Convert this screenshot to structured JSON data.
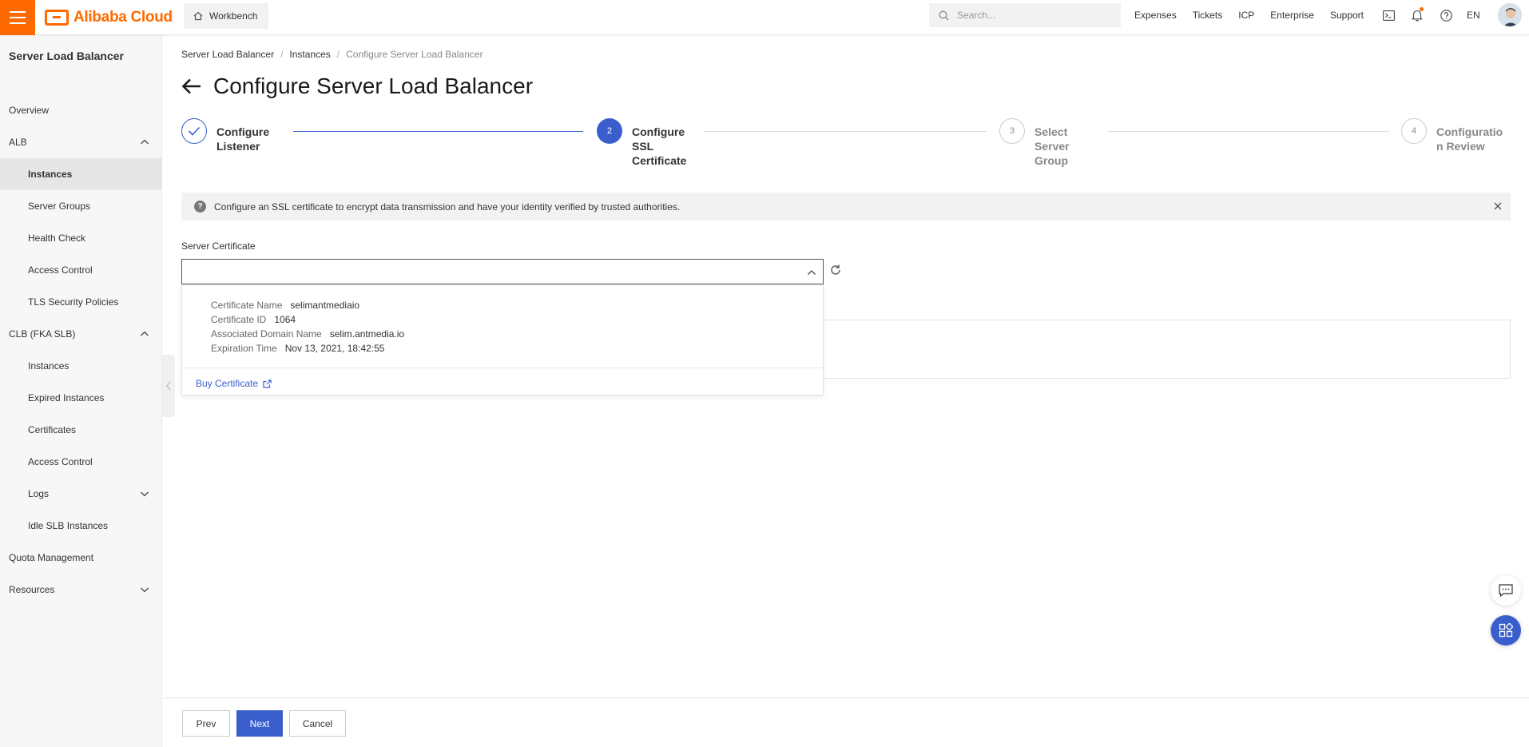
{
  "brand": {
    "logo_text": "Alibaba Cloud",
    "accent": "#ff6a00",
    "primary": "#3a5fcd"
  },
  "topbar": {
    "workbench_label": "Workbench",
    "search_placeholder": "Search...",
    "links": [
      "Expenses",
      "Tickets",
      "ICP",
      "Enterprise",
      "Support"
    ],
    "language": "EN",
    "icons": [
      "terminal-icon",
      "bell-icon",
      "help-icon"
    ]
  },
  "sidebar": {
    "title": "Server Load Balancer",
    "items": [
      {
        "label": "Overview"
      },
      {
        "label": "ALB"
      },
      {
        "label": "Instances"
      },
      {
        "label": "Server Groups"
      },
      {
        "label": "Health Check"
      },
      {
        "label": "Access Control"
      },
      {
        "label": "TLS Security Policies"
      },
      {
        "label": "CLB (FKA SLB)"
      },
      {
        "label": "Instances"
      },
      {
        "label": "Expired Instances"
      },
      {
        "label": "Certificates"
      },
      {
        "label": "Access Control"
      },
      {
        "label": "Logs"
      },
      {
        "label": "Idle SLB Instances"
      },
      {
        "label": "Quota Management"
      },
      {
        "label": "Resources"
      }
    ]
  },
  "breadcrumb": [
    "Server Load Balancer",
    "Instances",
    "Configure Server Load Balancer"
  ],
  "page": {
    "title": "Configure Server Load Balancer"
  },
  "steps": [
    {
      "number": "",
      "line1": "Configure",
      "line2": "Listener",
      "line3": "",
      "status": "done"
    },
    {
      "number": "2",
      "line1": "Configure",
      "line2": "SSL",
      "line3": "Certificate",
      "status": "current"
    },
    {
      "number": "3",
      "line1": "Select",
      "line2": "Server",
      "line3": "Group",
      "status": "wait"
    },
    {
      "number": "4",
      "line1": "Configuratio",
      "line2": "n Review",
      "line3": "",
      "status": "wait"
    }
  ],
  "alert": {
    "text": "Configure an SSL certificate to encrypt data transmission and have your identity verified by trusted authorities."
  },
  "form": {
    "server_certificate_label": "Server Certificate",
    "server_certificate_value": "",
    "dropdown": {
      "option": {
        "name_key": "Certificate Name",
        "name_value": "selimantmediaio",
        "id_key": "Certificate ID",
        "id_value": "1064",
        "domain_key": "Associated Domain Name",
        "domain_value": "selim.antmedia.io",
        "expiry_key": "Expiration Time",
        "expiry_value": "Nov 13, 2021, 18:42:55"
      },
      "buy_label": "Buy Certificate"
    }
  },
  "footer": {
    "prev_label": "Prev",
    "next_label": "Next",
    "cancel_label": "Cancel"
  }
}
